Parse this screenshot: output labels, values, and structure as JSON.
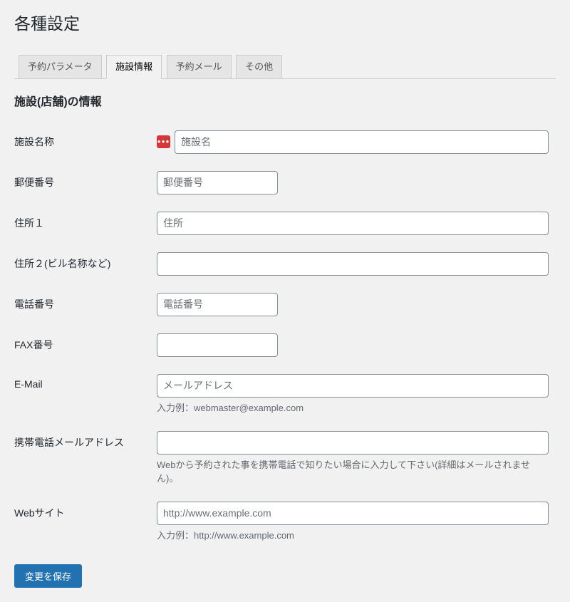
{
  "page_title": "各種設定",
  "tabs": [
    {
      "label": "予約パラメータ"
    },
    {
      "label": "施設情報"
    },
    {
      "label": "予約メール"
    },
    {
      "label": "その他"
    }
  ],
  "section_heading": "施設(店舗)の情報",
  "fields": {
    "name": {
      "label": "施設名称",
      "placeholder": "施設名"
    },
    "postal": {
      "label": "郵便番号",
      "placeholder": "郵便番号"
    },
    "address1": {
      "label": "住所１",
      "placeholder": "住所"
    },
    "address2": {
      "label": "住所２(ビル名称など)"
    },
    "tel": {
      "label": "電話番号",
      "placeholder": "電話番号"
    },
    "fax": {
      "label": "FAX番号"
    },
    "email": {
      "label": "E-Mail",
      "placeholder": "メールアドレス",
      "hint": "入力例：webmaster@example.com"
    },
    "mobile_email": {
      "label": "携帯電話メールアドレス",
      "hint": "Webから予約された事を携帯電話で知りたい場合に入力して下さい(詳細はメールされません)。"
    },
    "website": {
      "label": "Webサイト",
      "placeholder": "http://www.example.com",
      "hint": "入力例：http://www.example.com"
    }
  },
  "required_badge": "●●●",
  "save_button": "変更を保存"
}
